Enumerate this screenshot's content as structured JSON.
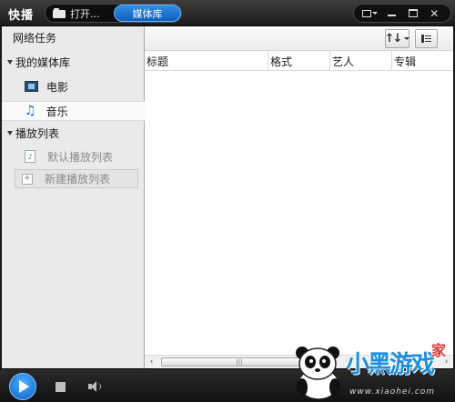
{
  "app": {
    "title": "快播"
  },
  "titlebar": {
    "open_label": "打开...",
    "media_tab_label": "媒体库",
    "buttons": [
      "skin-menu",
      "minimize",
      "maximize",
      "close"
    ],
    "accent_color": "#1d78d6"
  },
  "sidebar": {
    "network_tasks": "网络任务",
    "my_library": "我的媒体库",
    "library_items": [
      {
        "label": "电影",
        "icon": "film-icon"
      },
      {
        "label": "音乐",
        "icon": "music-note-icon",
        "selected": true
      }
    ],
    "playlists": "播放列表",
    "playlist_items": [
      {
        "label": "默认播放列表",
        "icon": "playlist-icon"
      }
    ],
    "new_playlist": "新建播放列表"
  },
  "table": {
    "columns": [
      "标题",
      "格式",
      "艺人",
      "专辑"
    ],
    "rows": []
  },
  "scrollbar": {
    "left_arrow": "‹",
    "right_arrow": "›",
    "grip": "|||"
  },
  "watermark": {
    "text": "小黑游戏",
    "sub": "家",
    "url": "www.xiaohei.com"
  }
}
